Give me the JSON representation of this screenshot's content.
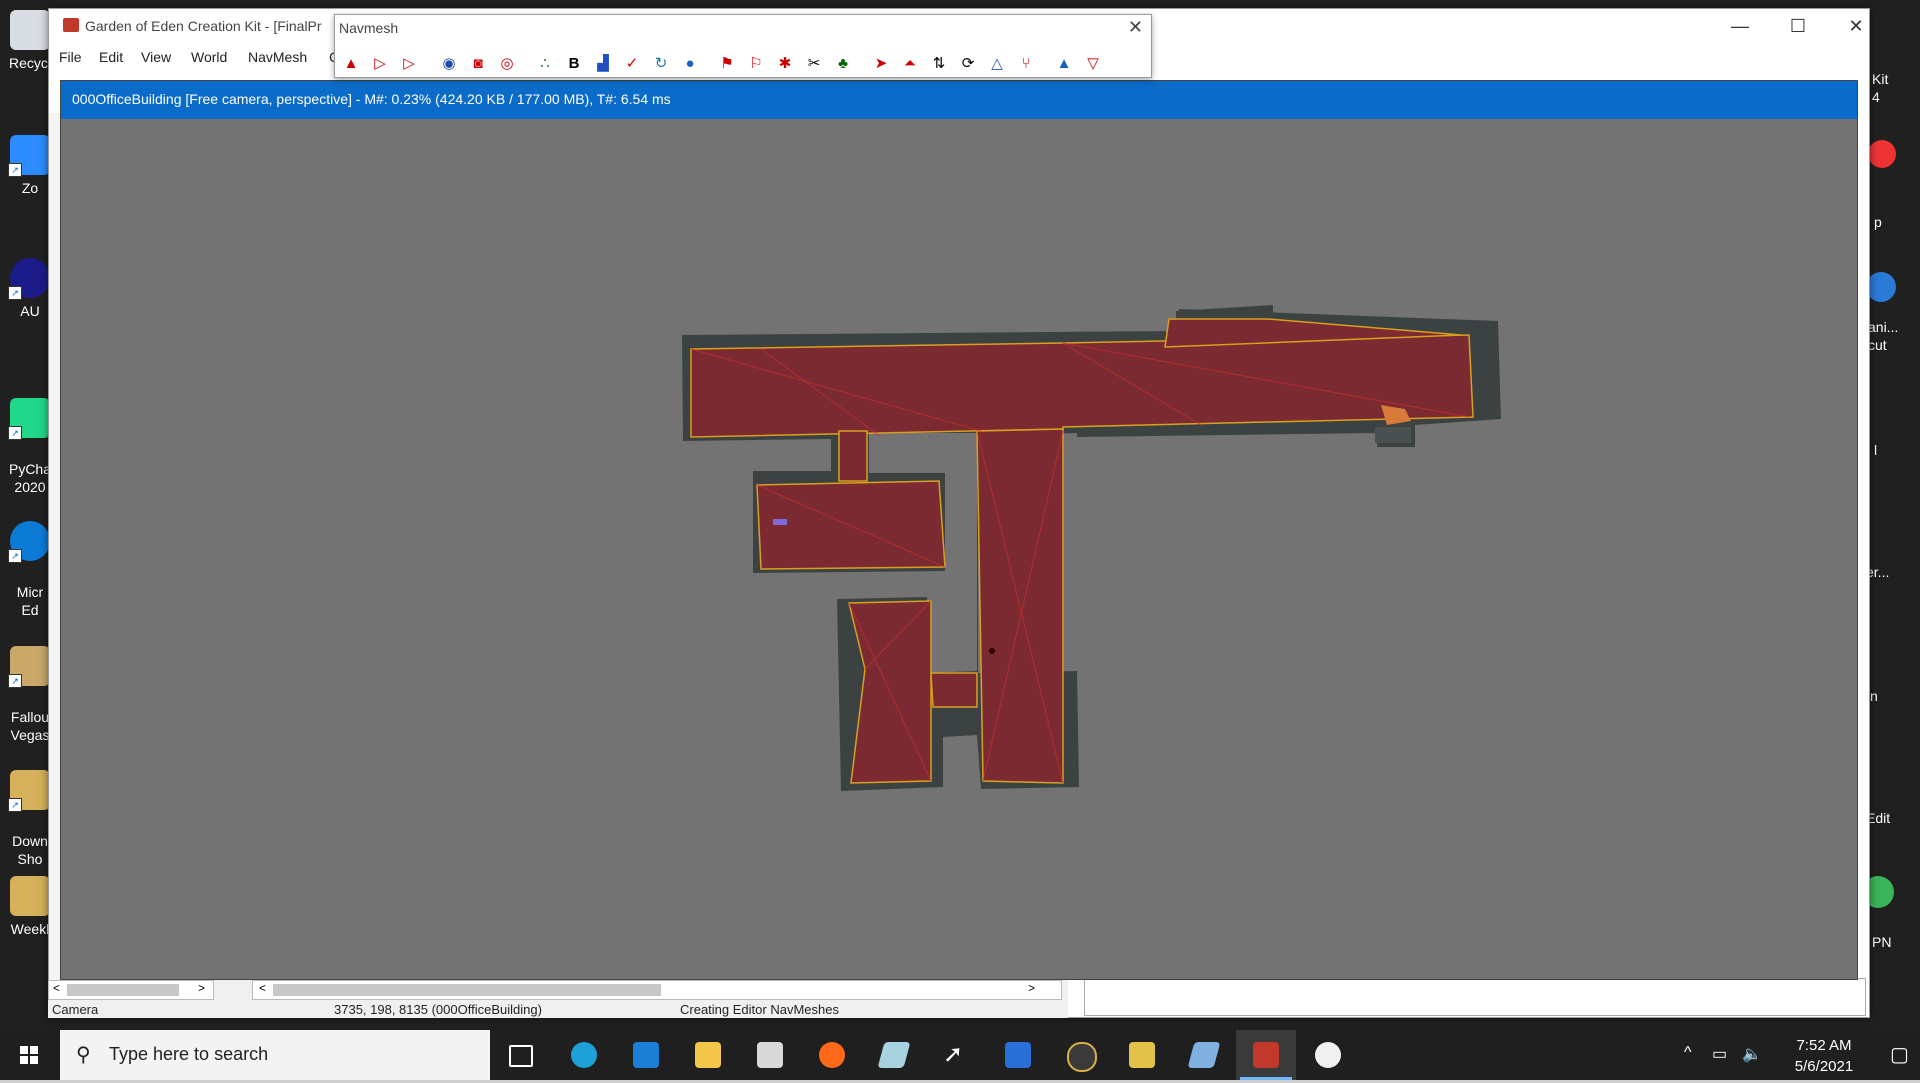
{
  "desktop": {
    "icons": [
      {
        "label": "Recycl",
        "color": "#d8dde3"
      },
      {
        "label": "Zo",
        "color": "#2d8cff"
      },
      {
        "label": "AU",
        "color": "#1b1b8a"
      },
      {
        "label": "PyCha\n2020",
        "color": "#21d789"
      },
      {
        "label": "Micr\nEd",
        "color": "#0c7bd6"
      },
      {
        "label": "Fallou\nVegas",
        "color": "#c9a86a"
      },
      {
        "label": "Down\nSho",
        "color": "#d4b15a"
      },
      {
        "label": "Weekl",
        "color": "#d4b15a"
      }
    ],
    "right_labels": [
      "Kit\n4",
      "p",
      "ani...\ncut",
      "l",
      "er...",
      "n",
      "Edit",
      "PN"
    ]
  },
  "main_window": {
    "title": "Garden of Eden Creation Kit - [FinalPr",
    "menu": [
      "File",
      "Edit",
      "View",
      "World",
      "NavMesh",
      "C"
    ],
    "controls": {
      "minimize": "—",
      "maximize": "☐",
      "close": "✕"
    }
  },
  "navmesh_toolbar": {
    "title": "Navmesh",
    "close": "✕",
    "tools": [
      "create-triangle",
      "create-triangle-outline",
      "create-triangle-light",
      "view-eye",
      "view-red-eye",
      "view-eye-2",
      "vertex-dots",
      "b-toggle",
      "cover",
      "check",
      "rotate",
      "help",
      "flag-red",
      "flag-outline",
      "flag-star",
      "sword",
      "palm",
      "arrow-red",
      "arrow-up-red",
      "arrows-updown",
      "rotate-cycle",
      "triangle-a",
      "fork",
      "mountain",
      "triangle-check"
    ]
  },
  "render_window": {
    "title": "000OfficeBuilding [Free camera, perspective] - M#: 0.23% (424.20 KB / 177.00 MB), T#: 6.54 ms",
    "background": "#737373",
    "accent": "#0a6bc8"
  },
  "status_bar": {
    "camera": "Camera",
    "coords": "3735, 198, 8135 (000OfficeBuilding)",
    "message": "Creating Editor NavMeshes"
  },
  "taskbar": {
    "search_placeholder": "Type here to search",
    "apps": [
      "task-view",
      "edge",
      "mail",
      "file-explorer",
      "notepad",
      "firefox",
      "eraser",
      "cursor-tool",
      "remote-desktop",
      "settings-app",
      "notes",
      "gems",
      "creation-kit",
      "paint"
    ],
    "time": "7:52 AM",
    "date": "5/6/2021"
  }
}
